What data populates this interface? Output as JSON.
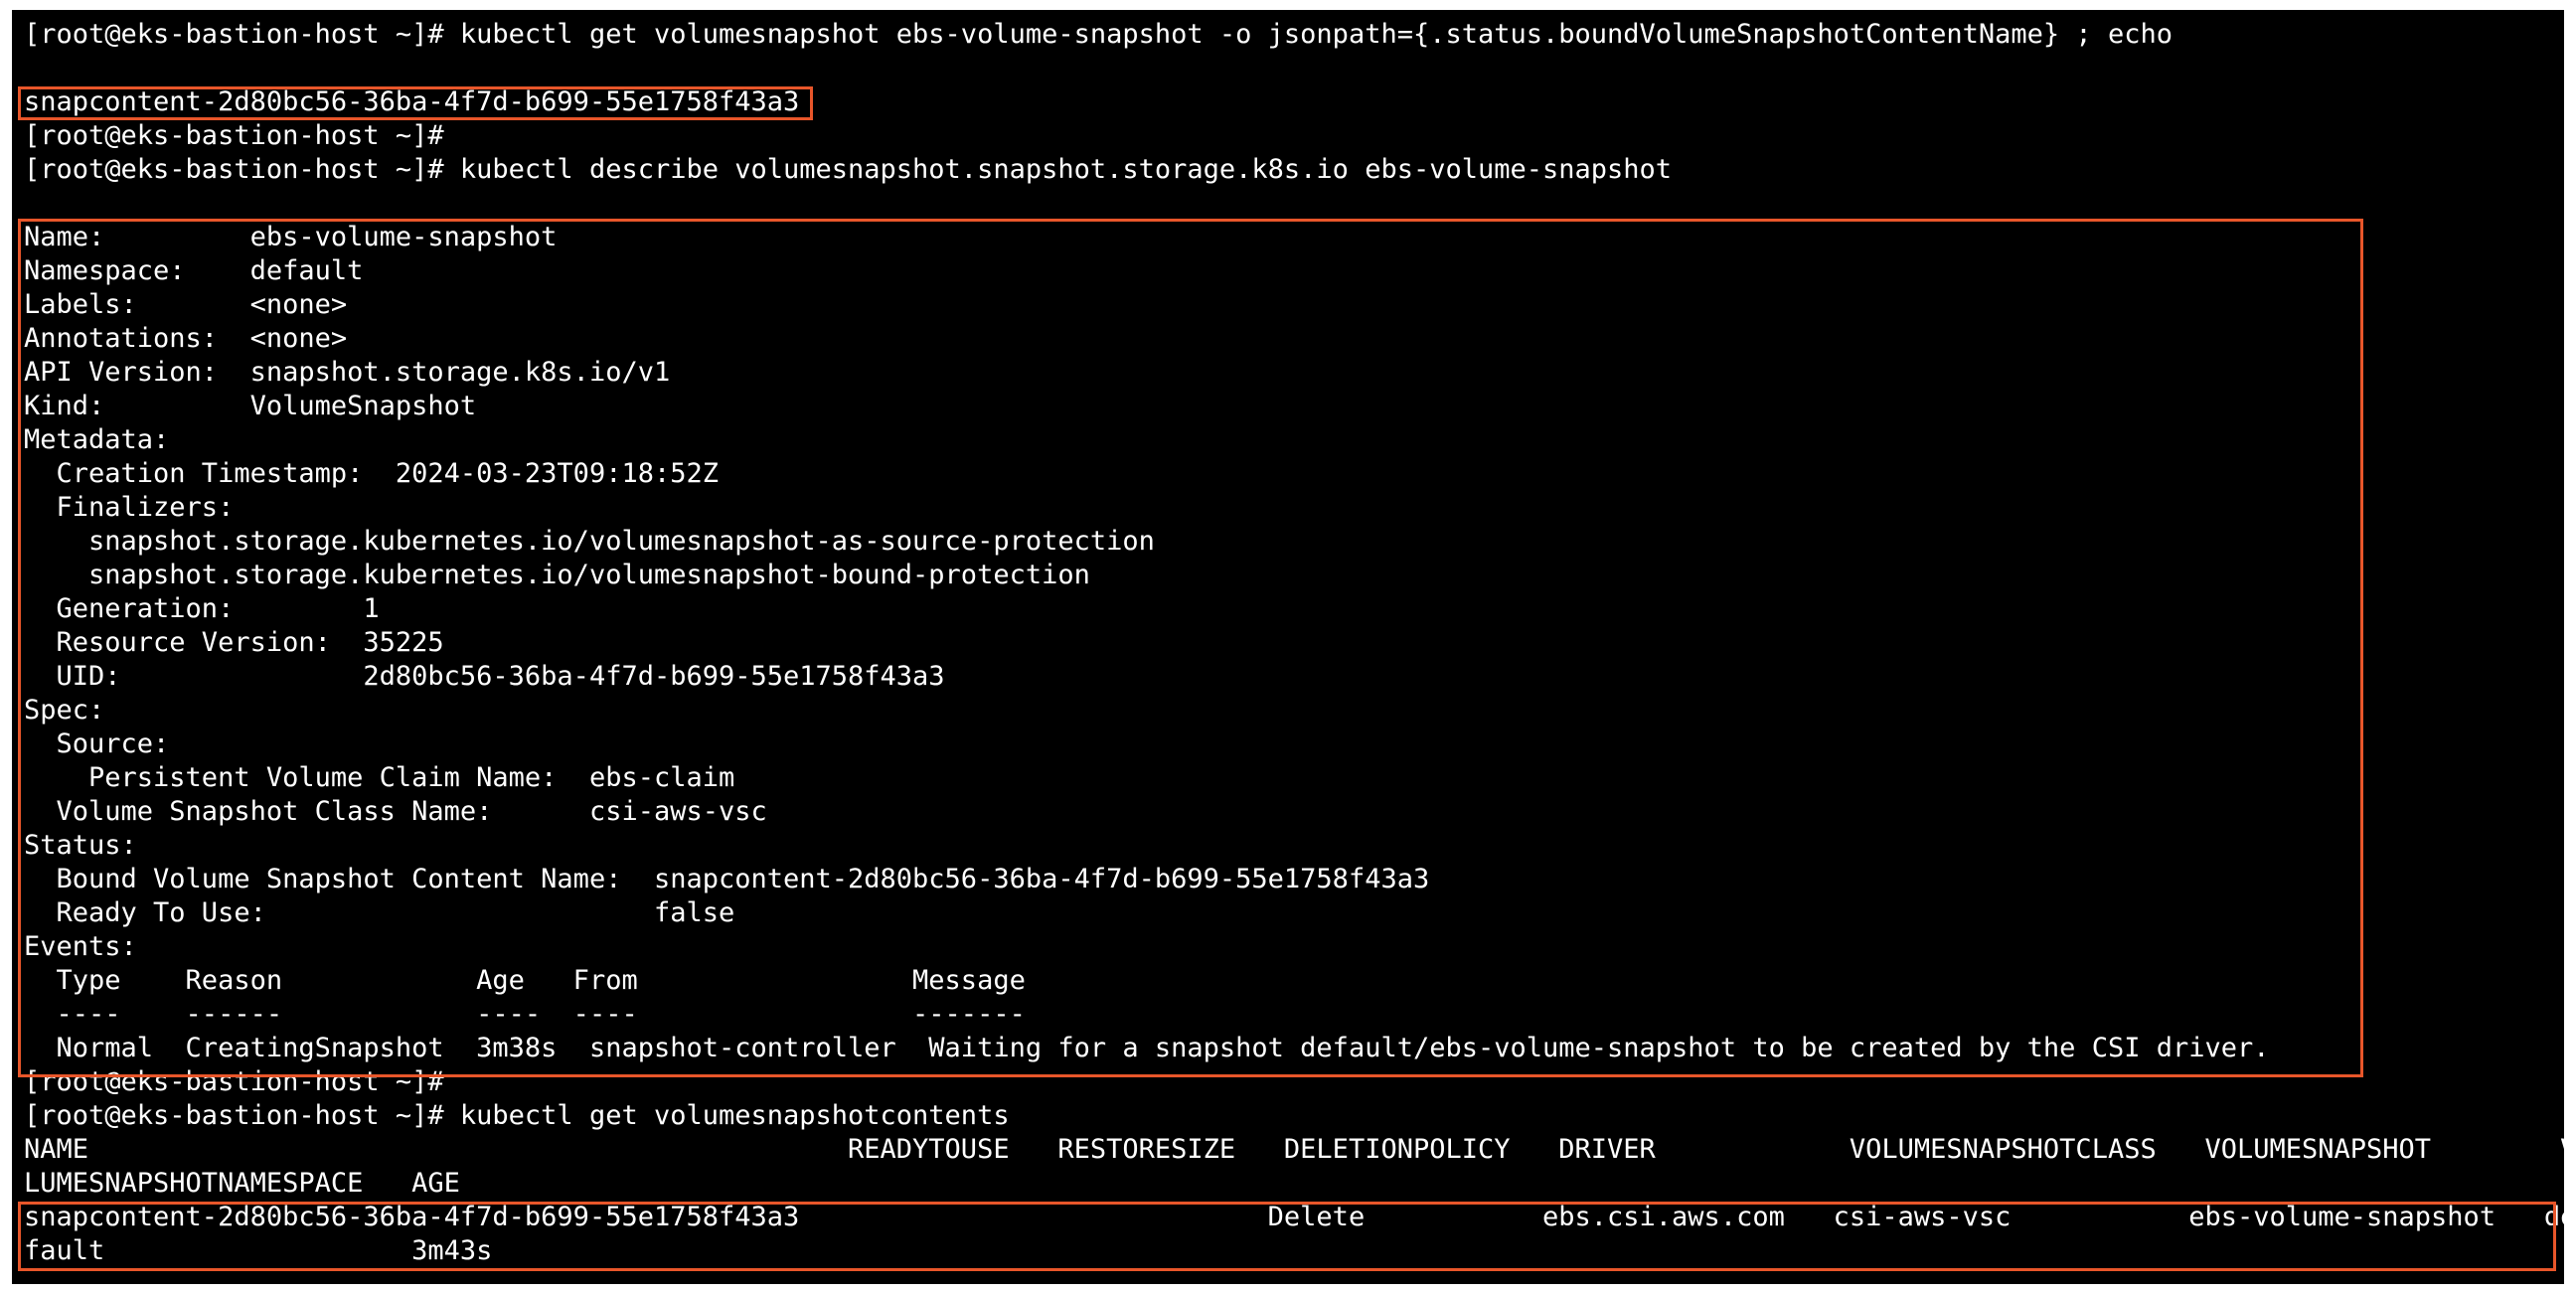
{
  "theme": {
    "background": "#000000",
    "foreground": "#ffffff",
    "highlight": "#e8562a"
  },
  "lines": [
    "[root@eks-bastion-host ~]# kubectl get volumesnapshot ebs-volume-snapshot -o jsonpath={.status.boundVolumeSnapshotContentName} ; echo",
    "",
    "snapcontent-2d80bc56-36ba-4f7d-b699-55e1758f43a3",
    "[root@eks-bastion-host ~]#",
    "[root@eks-bastion-host ~]# kubectl describe volumesnapshot.snapshot.storage.k8s.io ebs-volume-snapshot",
    "",
    "Name:         ebs-volume-snapshot",
    "Namespace:    default",
    "Labels:       <none>",
    "Annotations:  <none>",
    "API Version:  snapshot.storage.k8s.io/v1",
    "Kind:         VolumeSnapshot",
    "Metadata:",
    "  Creation Timestamp:  2024-03-23T09:18:52Z",
    "  Finalizers:",
    "    snapshot.storage.kubernetes.io/volumesnapshot-as-source-protection",
    "    snapshot.storage.kubernetes.io/volumesnapshot-bound-protection",
    "  Generation:        1",
    "  Resource Version:  35225",
    "  UID:               2d80bc56-36ba-4f7d-b699-55e1758f43a3",
    "Spec:",
    "  Source:",
    "    Persistent Volume Claim Name:  ebs-claim",
    "  Volume Snapshot Class Name:      csi-aws-vsc",
    "Status:",
    "  Bound Volume Snapshot Content Name:  snapcontent-2d80bc56-36ba-4f7d-b699-55e1758f43a3",
    "  Ready To Use:                        false",
    "Events:",
    "  Type    Reason            Age   From                 Message",
    "  ----    ------            ----  ----                 -------",
    "  Normal  CreatingSnapshot  3m38s  snapshot-controller  Waiting for a snapshot default/ebs-volume-snapshot to be created by the CSI driver.",
    "[root@eks-bastion-host ~]#",
    "[root@eks-bastion-host ~]# kubectl get volumesnapshotcontents",
    "NAME                                               READYTOUSE   RESTORESIZE   DELETIONPOLICY   DRIVER            VOLUMESNAPSHOTCLASS   VOLUMESNAPSHOT        VO",
    "LUMESNAPSHOTNAMESPACE   AGE",
    "snapcontent-2d80bc56-36ba-4f7d-b699-55e1758f43a3                             Delete           ebs.csi.aws.com   csi-aws-vsc           ebs-volume-snapshot   de",
    "fault                   3m43s"
  ]
}
